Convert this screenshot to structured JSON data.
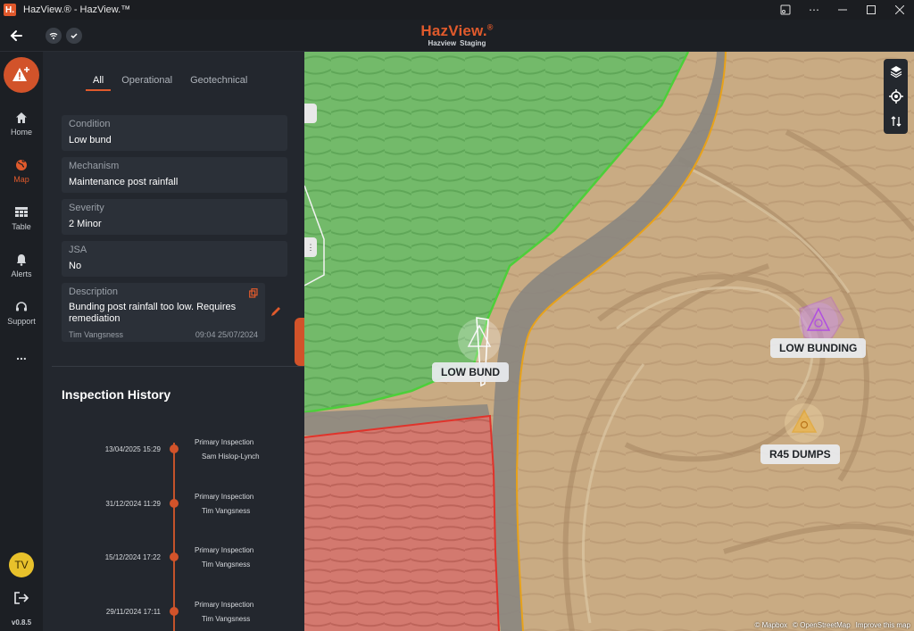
{
  "window": {
    "logo_letter": "H.",
    "title": "HazView.® - HazView.™",
    "controls": [
      "cast-icon",
      "more-icon",
      "minimize-icon",
      "maximize-icon",
      "close-icon"
    ]
  },
  "header": {
    "brand": "HazView.",
    "brand_mark": "®",
    "sub_left": "Hazview",
    "sub_right": "Staging"
  },
  "rail": {
    "items": [
      {
        "label": "Home",
        "icon": "home-icon"
      },
      {
        "label": "Map",
        "icon": "globe-icon",
        "active": true
      },
      {
        "label": "Table",
        "icon": "table-icon"
      },
      {
        "label": "Alerts",
        "icon": "bell-icon"
      },
      {
        "label": "Support",
        "icon": "headset-icon"
      }
    ],
    "more": "...",
    "avatar": "TV",
    "version": "v0.8.5"
  },
  "panel": {
    "tabs": [
      "All",
      "Operational",
      "Geotechnical"
    ],
    "fields": [
      {
        "label": "Condition",
        "value": "Low bund"
      },
      {
        "label": "Mechanism",
        "value": "Maintenance post rainfall"
      },
      {
        "label": "Severity",
        "value": "2 Minor"
      },
      {
        "label": "JSA",
        "value": "No"
      }
    ],
    "description": {
      "label": "Description",
      "value": "Bunding post rainfall too low. Requires remediation",
      "author": "Tim Vangsness",
      "timestamp": "09:04 25/07/2024"
    },
    "history_title": "Inspection History",
    "history": [
      {
        "date": "13/04/2025 15:29",
        "type": "Primary Inspection",
        "user": "Sam Hislop-Lynch"
      },
      {
        "date": "31/12/2024 11:29",
        "type": "Primary Inspection",
        "user": "Tim Vangsness"
      },
      {
        "date": "15/12/2024 17:22",
        "type": "Primary Inspection",
        "user": "Tim Vangsness"
      },
      {
        "date": "29/11/2024 17:11",
        "type": "Primary Inspection",
        "user": "Tim Vangsness"
      }
    ]
  },
  "map": {
    "labels": {
      "low_bund": "LOW BUND",
      "low_bunding": "LOW BUNDING",
      "r45_dumps": "R45 DUMPS"
    },
    "attribution": [
      "© Mapbox",
      "© OpenStreetMap",
      "Improve this map"
    ],
    "colors": {
      "green_zone": "#4ccf3a",
      "red_zone": "#e0332b",
      "road_edge": "#e8a21a",
      "purple_hazard": "#b04fe0",
      "orange_hazard": "#e8a21a"
    }
  }
}
